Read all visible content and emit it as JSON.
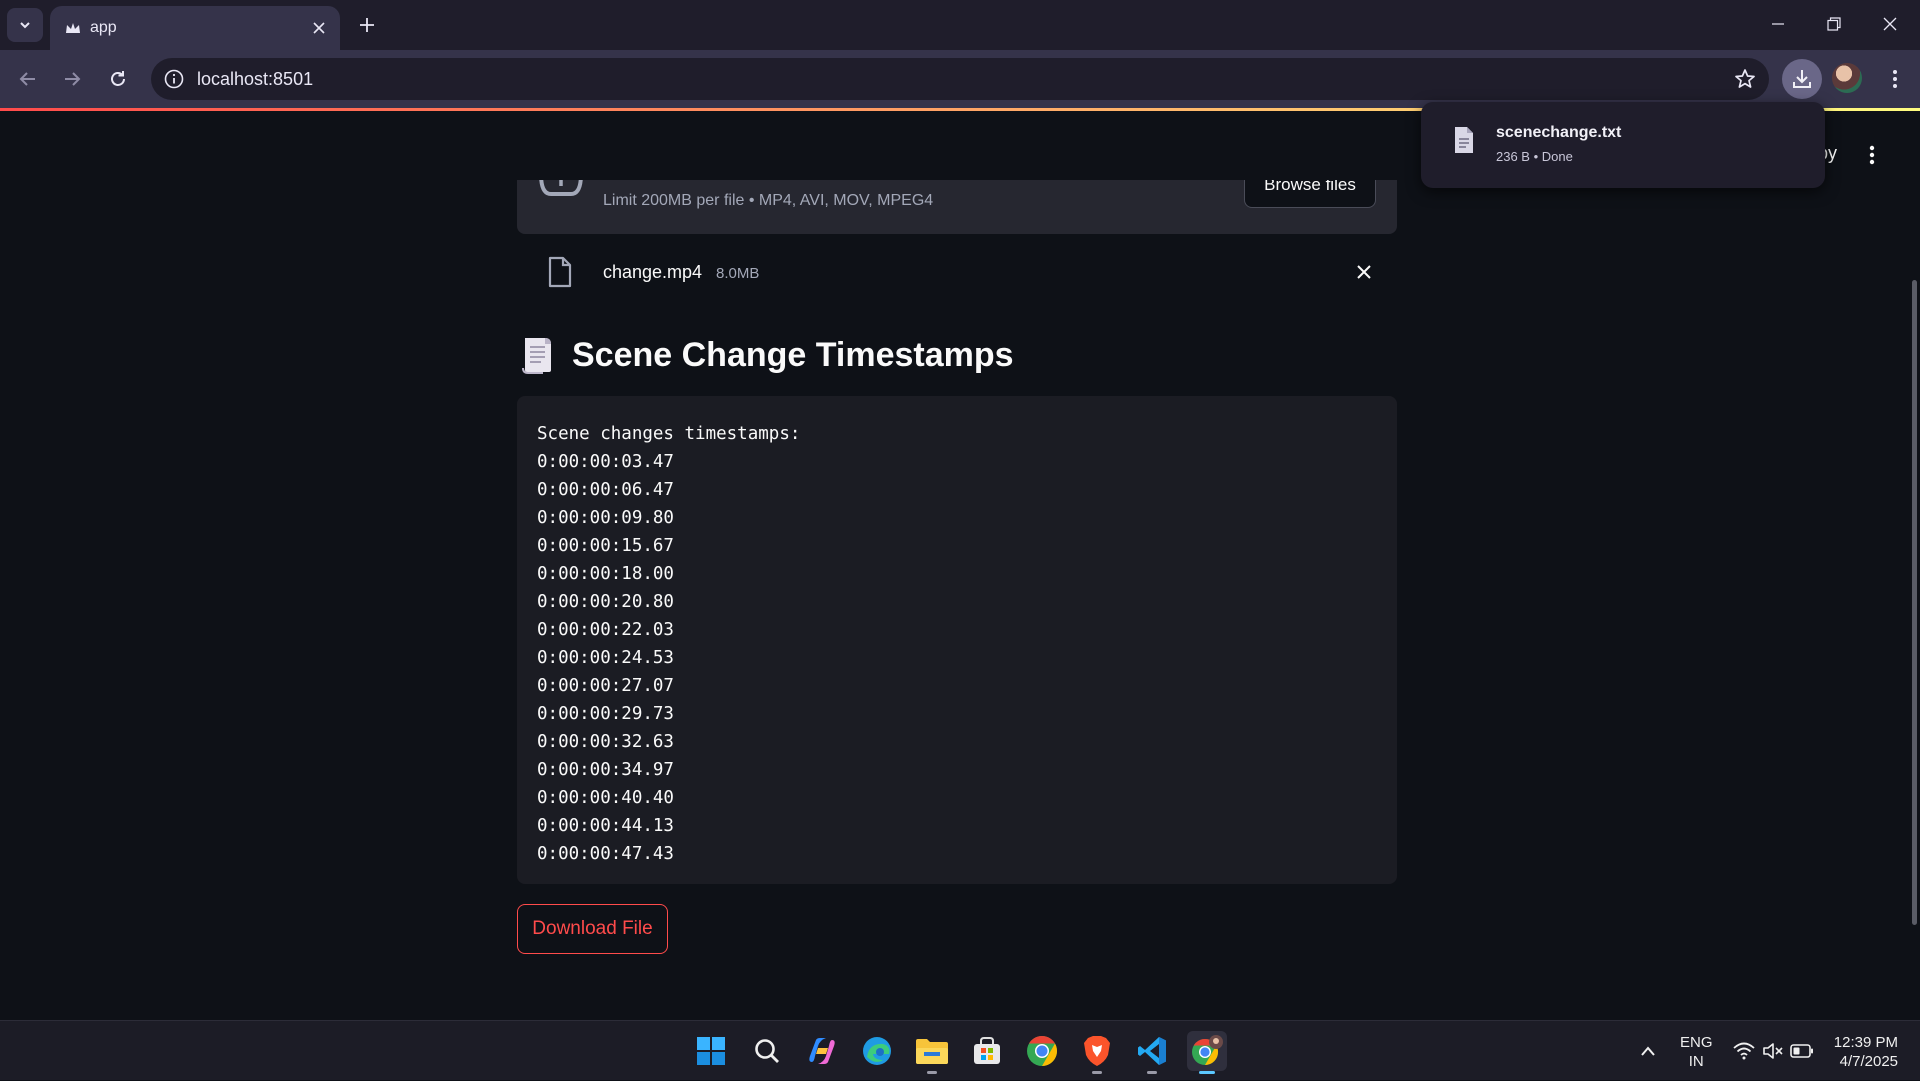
{
  "browser": {
    "tab_title": "app",
    "url": "localhost:8501"
  },
  "download_bubble": {
    "file_name": "scenechange.txt",
    "meta": "236 B • Done"
  },
  "app": {
    "header_partial_text": "py",
    "uploader": {
      "limit_text": "Limit 200MB per file • MP4, AVI, MOV, MPEG4",
      "browse_label": "Browse files"
    },
    "uploaded_file": {
      "name": "change.mp4",
      "size": "8.0MB"
    },
    "section_title": "Scene Change Timestamps",
    "code_lines": [
      "Scene changes timestamps:",
      "0:00:00:03.47",
      "0:00:00:06.47",
      "0:00:00:09.80",
      "0:00:00:15.67",
      "0:00:00:18.00",
      "0:00:00:20.80",
      "0:00:00:22.03",
      "0:00:00:24.53",
      "0:00:00:27.07",
      "0:00:00:29.73",
      "0:00:00:32.63",
      "0:00:00:34.97",
      "0:00:00:40.40",
      "0:00:00:44.13",
      "0:00:00:47.43"
    ],
    "download_label": "Download File",
    "accent_color": "#ff4b4b"
  },
  "taskbar": {
    "apps": [
      "windows-start",
      "search",
      "copilot",
      "edge",
      "file-explorer",
      "microsoft-store",
      "chrome",
      "brave",
      "vscode",
      "chrome-profile"
    ],
    "lang_primary": "ENG",
    "lang_secondary": "IN",
    "time": "12:39 PM",
    "date": "4/7/2025"
  }
}
